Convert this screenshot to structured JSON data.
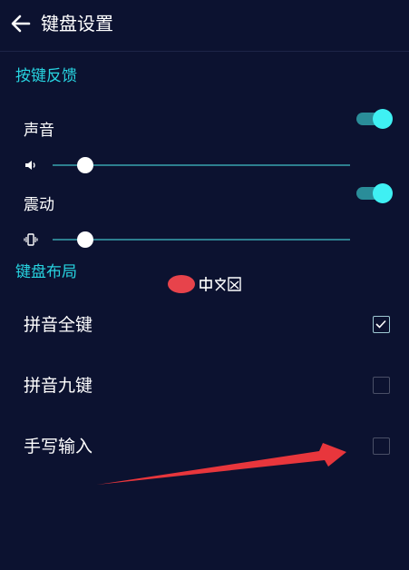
{
  "header": {
    "title": "键盘设置",
    "back_icon": "arrow-left-icon"
  },
  "sections": {
    "feedback": {
      "title": "按键反馈",
      "sound": {
        "label": "声音",
        "enabled": true,
        "volume": 0.11
      },
      "vibration": {
        "label": "震动",
        "enabled": true,
        "strength": 0.11
      }
    },
    "layout": {
      "title": "键盘布局",
      "options": [
        {
          "label": "拼音全键",
          "checked": true
        },
        {
          "label": "拼音九键",
          "checked": false
        },
        {
          "label": "手写输入",
          "checked": false
        }
      ]
    }
  },
  "colors": {
    "background": "#0c1230",
    "accent": "#27d3e0",
    "toggle_knob": "#3ff0f3",
    "toggle_track": "#2a8d99",
    "arrow": "#e8363c"
  }
}
